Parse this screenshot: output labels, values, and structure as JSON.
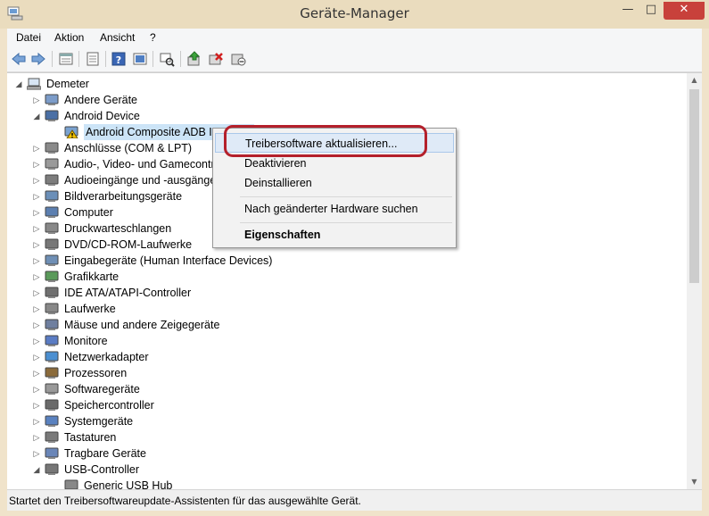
{
  "window": {
    "title": "Geräte-Manager",
    "controls": {
      "minimize": "—",
      "maximize": "□",
      "close": "✕"
    }
  },
  "menu": [
    "Datei",
    "Aktion",
    "Ansicht",
    "?"
  ],
  "toolbar": {
    "icons": [
      "back-icon",
      "forward-icon",
      "properties-sheet-icon",
      "view-icon",
      "help-icon",
      "device-view-icon",
      "scan-hardware-icon",
      "update-driver-icon",
      "uninstall-icon",
      "disable-icon"
    ]
  },
  "tree": {
    "root": "Demeter",
    "items": [
      {
        "label": "Andere Geräte",
        "state": "collapsed"
      },
      {
        "label": "Android Device",
        "state": "expanded"
      },
      {
        "label": "Android Composite ADB Interface",
        "child": true,
        "warning": true
      },
      {
        "label": "Anschlüsse (COM & LPT)",
        "state": "collapsed"
      },
      {
        "label": "Audio-, Video- und Gamecontroller",
        "state": "collapsed"
      },
      {
        "label": "Audioeingänge und -ausgänge",
        "state": "collapsed"
      },
      {
        "label": "Bildverarbeitungsgeräte",
        "state": "collapsed"
      },
      {
        "label": "Computer",
        "state": "collapsed"
      },
      {
        "label": "Druckwarteschlangen",
        "state": "collapsed"
      },
      {
        "label": "DVD/CD-ROM-Laufwerke",
        "state": "collapsed"
      },
      {
        "label": "Eingabegeräte (Human Interface Devices)",
        "state": "collapsed"
      },
      {
        "label": "Grafikkarte",
        "state": "collapsed"
      },
      {
        "label": "IDE ATA/ATAPI-Controller",
        "state": "collapsed"
      },
      {
        "label": "Laufwerke",
        "state": "collapsed"
      },
      {
        "label": "Mäuse und andere Zeigegeräte",
        "state": "collapsed"
      },
      {
        "label": "Monitore",
        "state": "collapsed"
      },
      {
        "label": "Netzwerkadapter",
        "state": "collapsed"
      },
      {
        "label": "Prozessoren",
        "state": "collapsed"
      },
      {
        "label": "Softwaregeräte",
        "state": "collapsed"
      },
      {
        "label": "Speichercontroller",
        "state": "collapsed"
      },
      {
        "label": "Systemgeräte",
        "state": "collapsed"
      },
      {
        "label": "Tastaturen",
        "state": "collapsed"
      },
      {
        "label": "Tragbare Geräte",
        "state": "collapsed"
      },
      {
        "label": "USB-Controller",
        "state": "expanded"
      },
      {
        "label": "Generic USB Hub",
        "child": true
      }
    ]
  },
  "context_menu": {
    "items": [
      {
        "label": "Treibersoftware aktualisieren...",
        "highlighted": true
      },
      {
        "label": "Deaktivieren"
      },
      {
        "label": "Deinstallieren"
      },
      {
        "label": "Nach geänderter Hardware suchen"
      },
      {
        "label": "Eigenschaften",
        "bold": true
      }
    ]
  },
  "status": "Startet den Treibersoftwareupdate-Assistenten für das ausgewählte Gerät.",
  "colors": {
    "highlight_ring": "#b4202b",
    "menu_highlight": "#dfeaf7",
    "warning": "#f2c200"
  }
}
